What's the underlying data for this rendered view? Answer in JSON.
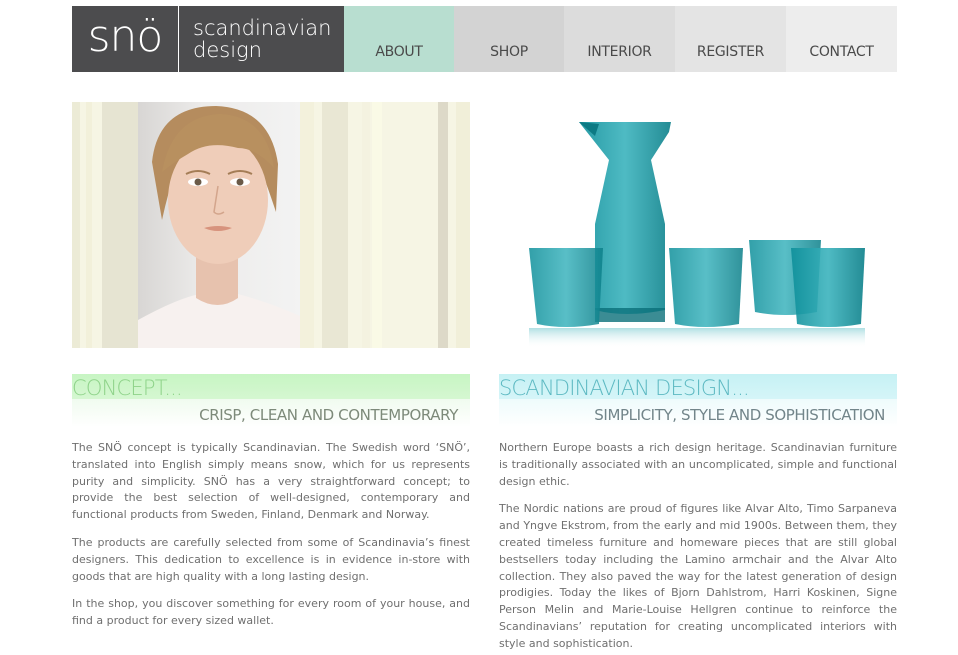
{
  "brand": {
    "mark": "snö",
    "tagline_line1": "scandinavian",
    "tagline_line2": "design"
  },
  "nav": {
    "items": [
      {
        "label": "ABOUT",
        "color": "#b8ded0"
      },
      {
        "label": "SHOP",
        "color": "#d3d3d3"
      },
      {
        "label": "INTERIOR",
        "color": "#dcdcdc"
      },
      {
        "label": "REGISTER",
        "color": "#e4e4e4"
      },
      {
        "label": "CONTACT",
        "color": "#ededed"
      }
    ]
  },
  "concept": {
    "title": "CONCEPT...",
    "subtitle": "CRISP, CLEAN AND CONTEMPORARY",
    "paragraphs": [
      "The SNÖ concept is typically Scandinavian. The Swedish word ‘SNÖ’, translated into English simply means snow, which for us represents purity and simplicity. SNÖ has a very straightforward concept; to provide the best selection of well-designed, contemporary and functional products from Sweden, Finland, Denmark and Norway.",
      "The products are carefully selected from some of Scandinavia’s finest designers. This dedication to excellence is in evidence in-store with goods that are high quality with a long lasting design.",
      "In the shop, you discover something for every room of your house, and find a product for every sized wallet."
    ],
    "accent": "#8fd38a"
  },
  "scandinavian_design": {
    "title": "SCANDINAVIAN DESIGN...",
    "subtitle": "SIMPLICITY, STYLE AND SOPHISTICATION",
    "paragraphs": [
      "Northern Europe boasts a rich design heritage. Scandinavian furniture is traditionally associated with an uncomplicated, simple and functional design ethic.",
      "The Nordic nations are proud of figures like Alvar Alto, Timo Sarpaneva and Yngve Ekstrom, from the early and mid 1900s. Between them, they created timeless furniture and homeware pieces that are still global bestsellers today including the Lamino armchair and the Alvar Alto collection. They also paved the way for the latest generation of design prodigies. Today the likes of Bjorn Dahlstrom, Harri Koskinen, Signe Person Melin and Marie-Louise Hellgren continue to reinforce the Scandinavians’ reputation for creating uncomplicated interiors with style and sophistication."
    ],
    "accent": "#5db9c2"
  },
  "images": {
    "left": "portrait-photo",
    "right": "glassware-photo"
  }
}
